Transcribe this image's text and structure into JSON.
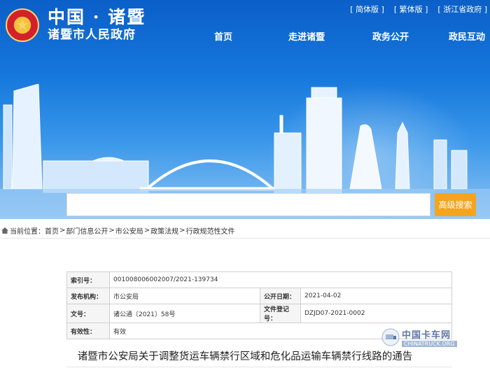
{
  "top_links": [
    "[ 简体版 ]",
    "[ 繁体版 ]",
    "[ 浙江省政府 ]"
  ],
  "logo": {
    "line1": "中国 · 诸暨",
    "line2": "诸暨市人民政府"
  },
  "nav": [
    "首页",
    "走进诸暨",
    "政务公开",
    "政民互动"
  ],
  "search": {
    "value": "",
    "button_label": "高级搜索"
  },
  "breadcrumb": {
    "prefix": "当前位置：",
    "items": [
      "首页",
      "部门信息公开",
      "市公安局",
      "政策法规",
      "行政规范性文件"
    ],
    "separator": ">"
  },
  "info_table": {
    "index_label": "索引号：",
    "index_value": "001008006002007/2021-139734",
    "org_label": "发布机构：",
    "org_value": "市公安局",
    "date_label": "公开日期：",
    "date_value": "2021-04-02",
    "doc_no_label": "文号：",
    "doc_no_value": "诸公通〔2021〕58号",
    "reg_label": "文件登记号：",
    "reg_value": "DZJD07-2021-0002",
    "validity_label": "有效性：",
    "validity_value": "有效"
  },
  "document_title": "诸暨市公安局关于调整货运车辆禁行区域和危化品运输车辆禁行线路的通告",
  "watermark": {
    "cn": "中国卡车网",
    "en": "CHINATRUCK.ORG"
  },
  "colors": {
    "banner_blue": "#0b5fc8",
    "search_button": "#f4a51d"
  }
}
